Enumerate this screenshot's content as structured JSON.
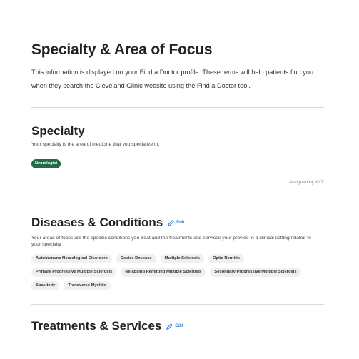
{
  "header": {
    "title": "Specialty & Area of Focus",
    "intro": "This information is displayed on your Find a Doctor profile. These terms will help patients find you when they search the Cleveland Clinic website using the Find a Doctor tool."
  },
  "specialty": {
    "title": "Specialty",
    "description": "Your specialty is the area of medicine that you specialize in.",
    "value": "Neurologist",
    "assigned_by": "Assigned by XYZ"
  },
  "diseases": {
    "title": "Diseases & Conditions",
    "edit_label": "Edit",
    "description": "Your areas of focus are the specific conditions you treat and the treatments and services your provide in a clinical setting related to your specialty",
    "items": [
      "Autoimmune Neurological Disorders",
      "Devics Desease",
      "Multiple Sclerosis",
      "Optic Neuritis",
      "Primary Progressive Multiple Sclerosis",
      "Relapsing Remitting Multiple Sclerosis",
      "Secondary Progressive Multiple Sclerosis",
      "Spasitcity",
      "Transverse Myelitis"
    ]
  },
  "treatments": {
    "title": "Treatments & Services",
    "edit_label": "Edit"
  },
  "colors": {
    "accent_green": "#1f6b47",
    "link_blue": "#2a7ad4",
    "chip_bg": "#f0f0f0"
  }
}
